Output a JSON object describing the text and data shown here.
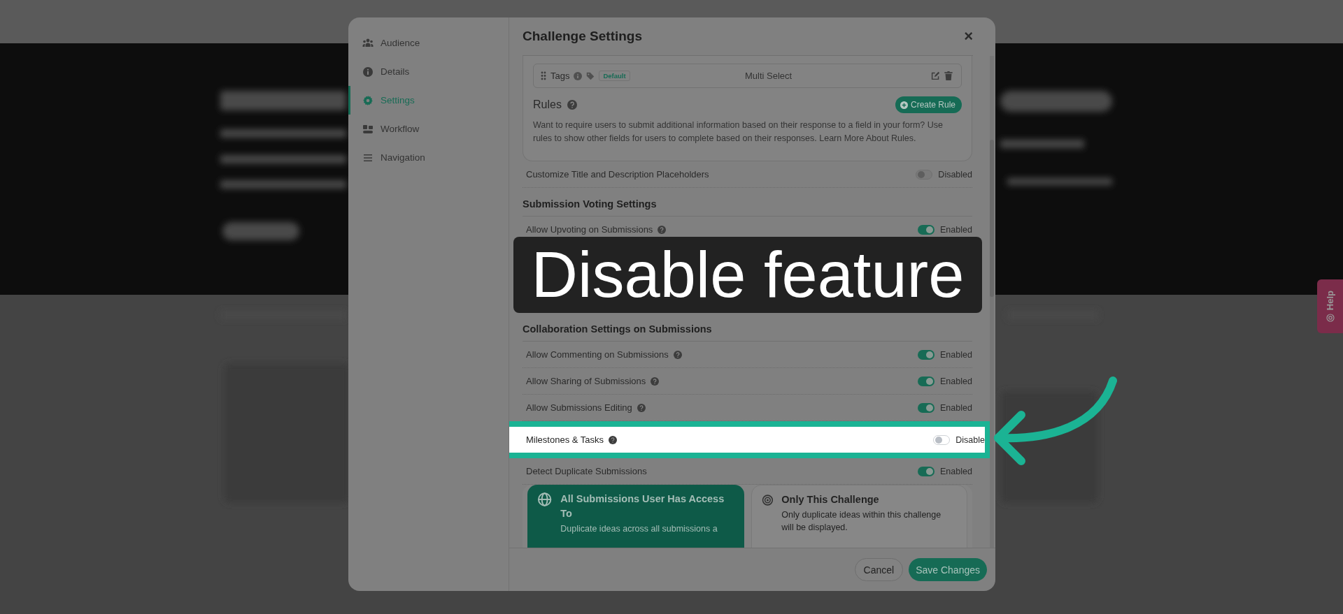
{
  "sidebar": {
    "items": [
      {
        "label": "Audience",
        "selected": false
      },
      {
        "label": "Details",
        "selected": false
      },
      {
        "label": "Settings",
        "selected": true
      },
      {
        "label": "Workflow",
        "selected": false
      },
      {
        "label": "Navigation",
        "selected": false
      }
    ]
  },
  "dialog": {
    "title": "Challenge Settings",
    "close": "×",
    "field": {
      "label": "Tags",
      "badge": "Default",
      "type": "Multi Select"
    },
    "rules": {
      "title": "Rules",
      "button": "Create Rule",
      "text": "Want to require users to submit additional information based on their response to a field in your form? Use rules to show other fields for users to complete based on their responses. Learn More About Rules."
    },
    "rows": [
      {
        "kind": "setting",
        "label": "Customize Title and Description Placeholders",
        "help": false,
        "on": false,
        "status": "Disabled",
        "highlighted": false
      },
      {
        "kind": "heading",
        "label": "Submission Voting Settings"
      },
      {
        "kind": "setting",
        "label": "Allow Upvoting on Submissions",
        "help": true,
        "on": true,
        "status": "Enabled",
        "highlighted": false
      },
      {
        "kind": "caption",
        "label": "Disable feature"
      },
      {
        "kind": "heading",
        "label": "Collaboration Settings on Submissions"
      },
      {
        "kind": "setting",
        "label": "Allow Commenting on Submissions",
        "help": true,
        "on": true,
        "status": "Enabled",
        "highlighted": false
      },
      {
        "kind": "setting",
        "label": "Allow Sharing of Submissions",
        "help": true,
        "on": true,
        "status": "Enabled",
        "highlighted": false
      },
      {
        "kind": "setting",
        "label": "Allow Submissions Editing",
        "help": true,
        "on": true,
        "status": "Enabled",
        "highlighted": false
      },
      {
        "kind": "setting",
        "label": "Milestones & Tasks",
        "help": true,
        "on": false,
        "status": "Disable",
        "highlighted": true
      },
      {
        "kind": "setting",
        "label": "Detect Duplicate Submissions",
        "help": false,
        "on": true,
        "status": "Enabled",
        "highlighted": false
      }
    ],
    "scope_options": [
      {
        "title": "All Submissions User Has Access To",
        "text": "Duplicate ideas across all submissions a",
        "selected": true
      },
      {
        "title": "Only This Challenge",
        "text": "Only duplicate ideas within this challenge will be displayed.",
        "selected": false
      }
    ],
    "cancel": "Cancel",
    "save": "Save Changes"
  },
  "help_tab": {
    "label": "Help"
  }
}
